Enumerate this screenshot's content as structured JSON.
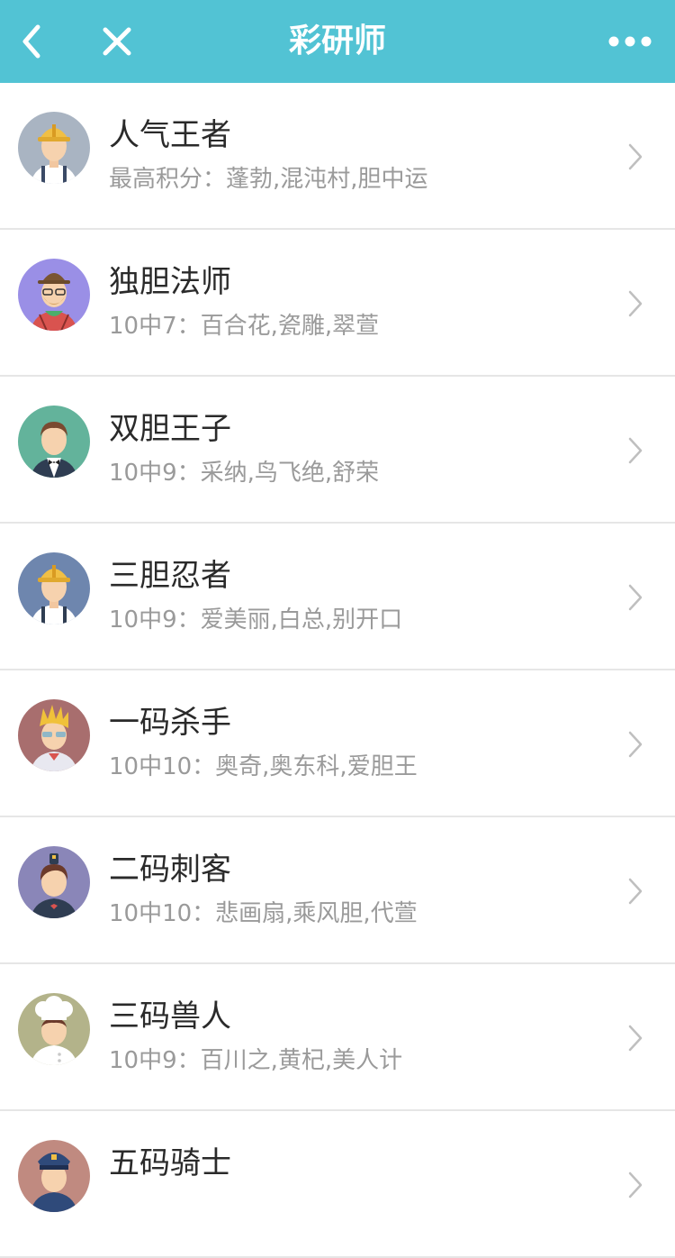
{
  "header": {
    "title": "彩研师",
    "back_icon": "chevron-left-icon",
    "close_icon": "close-icon",
    "more_icon": "more-dots-icon",
    "bg_color": "#52c3d4"
  },
  "rows": [
    {
      "title": "人气王者",
      "subtitle": "最高积分：蓬勃,混沌村,胆中运",
      "avatar": "hardhat-worker-avatar",
      "avatar_bg": "#a9b4c2"
    },
    {
      "title": "独胆法师",
      "subtitle": "10中7：百合花,瓷雕,翠萱",
      "avatar": "bearded-hat-avatar",
      "avatar_bg": "#9a8fe6"
    },
    {
      "title": "双胆王子",
      "subtitle": "10中9：采纳,鸟飞绝,舒荣",
      "avatar": "waiter-avatar",
      "avatar_bg": "#63b39b"
    },
    {
      "title": "三胆忍者",
      "subtitle": "10中9：爱美丽,白总,别开口",
      "avatar": "hardhat-worker-avatar",
      "avatar_bg": "#6e86ae"
    },
    {
      "title": "一码杀手",
      "subtitle": "10中10：奥奇,奥东科,爱胆王",
      "avatar": "sunglasses-avatar",
      "avatar_bg": "#a86e6e"
    },
    {
      "title": "二码刺客",
      "subtitle": "10中10：悲画扇,乘风胆,代萱",
      "avatar": "stewardess-avatar",
      "avatar_bg": "#8a86b8"
    },
    {
      "title": "三码兽人",
      "subtitle": "10中9：百川之,黄杞,美人计",
      "avatar": "chef-avatar",
      "avatar_bg": "#b3b38a"
    },
    {
      "title": "五码骑士",
      "subtitle": "",
      "avatar": "police-avatar",
      "avatar_bg": "#c08a80"
    }
  ]
}
